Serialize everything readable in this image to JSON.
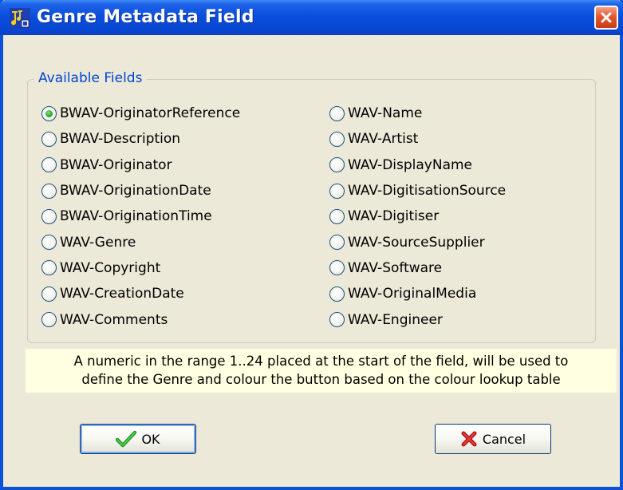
{
  "window": {
    "title": "Genre Metadata Field"
  },
  "group": {
    "label": "Available Fields"
  },
  "fields_left": [
    {
      "label": "BWAV-OriginatorReference",
      "checked": true
    },
    {
      "label": "BWAV-Description",
      "checked": false
    },
    {
      "label": "BWAV-Originator",
      "checked": false
    },
    {
      "label": "BWAV-OriginationDate",
      "checked": false
    },
    {
      "label": "BWAV-OriginationTime",
      "checked": false
    },
    {
      "label": "WAV-Genre",
      "checked": false
    },
    {
      "label": "WAV-Copyright",
      "checked": false
    },
    {
      "label": "WAV-CreationDate",
      "checked": false
    },
    {
      "label": "WAV-Comments",
      "checked": false
    }
  ],
  "fields_right": [
    {
      "label": "WAV-Name",
      "checked": false
    },
    {
      "label": "WAV-Artist",
      "checked": false
    },
    {
      "label": "WAV-DisplayName",
      "checked": false
    },
    {
      "label": "WAV-DigitisationSource",
      "checked": false
    },
    {
      "label": "WAV-Digitiser",
      "checked": false
    },
    {
      "label": "WAV-SourceSupplier",
      "checked": false
    },
    {
      "label": "WAV-Software",
      "checked": false
    },
    {
      "label": "WAV-OriginalMedia",
      "checked": false
    },
    {
      "label": "WAV-Engineer",
      "checked": false
    }
  ],
  "info": {
    "line1": "A numeric in the range 1..24 placed at the start of the field, will be used to",
    "line2": "define the Genre and colour the button based on the colour lookup table"
  },
  "buttons": {
    "ok": "OK",
    "cancel": "Cancel"
  },
  "icons": {
    "app": "audio-metadata-icon",
    "close": "close-icon",
    "ok": "green-checkmark-icon",
    "cancel": "red-x-icon"
  },
  "colors": {
    "titlebar": "#0a4fdd",
    "accent": "#0046d5",
    "selected_radio": "#2ea52e",
    "info_bg": "#ffffe1"
  }
}
